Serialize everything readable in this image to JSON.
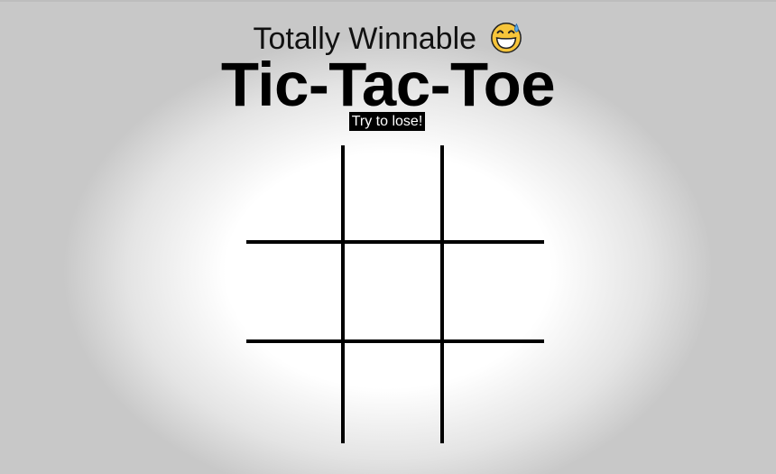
{
  "header": {
    "subtitle": "Totally Winnable",
    "subtitle_icon": "sweat-smile-emoji-icon",
    "title": "Tic-Tac-Toe",
    "tagline": "Try to lose!"
  },
  "board": {
    "rows": 3,
    "cols": 3,
    "cells": [
      "",
      "",
      "",
      "",
      "",
      "",
      "",
      "",
      ""
    ]
  },
  "colors": {
    "grid_lines": "#000000",
    "tagline_bg": "#000000",
    "tagline_text": "#ffffff",
    "emoji_face": "#f7c53a",
    "emoji_sweat": "#5aa9e6"
  }
}
